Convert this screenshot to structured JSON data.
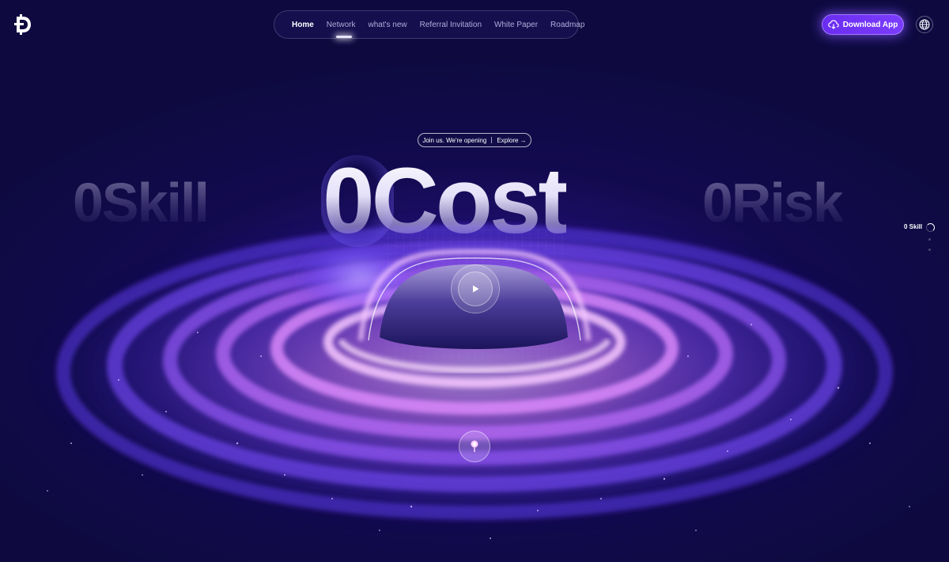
{
  "header": {
    "logo_icon": "d-coin-logo-icon",
    "nav_items": [
      {
        "label": "Home",
        "active": true
      },
      {
        "label": "Network",
        "active": false
      },
      {
        "label": "what's new",
        "active": false
      },
      {
        "label": "Referral Invitation",
        "active": false
      },
      {
        "label": "White Paper",
        "active": false
      },
      {
        "label": "Roadmap",
        "active": false
      }
    ],
    "download_button": {
      "label": "Download App",
      "icon": "cloud-download-icon"
    },
    "language_icon": "globe-icon"
  },
  "hero": {
    "announcement": {
      "text": "Join us. We're opening",
      "link": "Explore →"
    },
    "words": {
      "left": "0Skill",
      "main": "0Cost",
      "right": "0Risk"
    },
    "side_indicator": "0 Skill",
    "play_icon": "play-icon",
    "scroll_icon": "pin-icon"
  },
  "colors": {
    "background": "#120a4e",
    "accent": "#7b3cff",
    "ring_pink": "#e79cff",
    "ring_violet": "#7a4dff"
  }
}
